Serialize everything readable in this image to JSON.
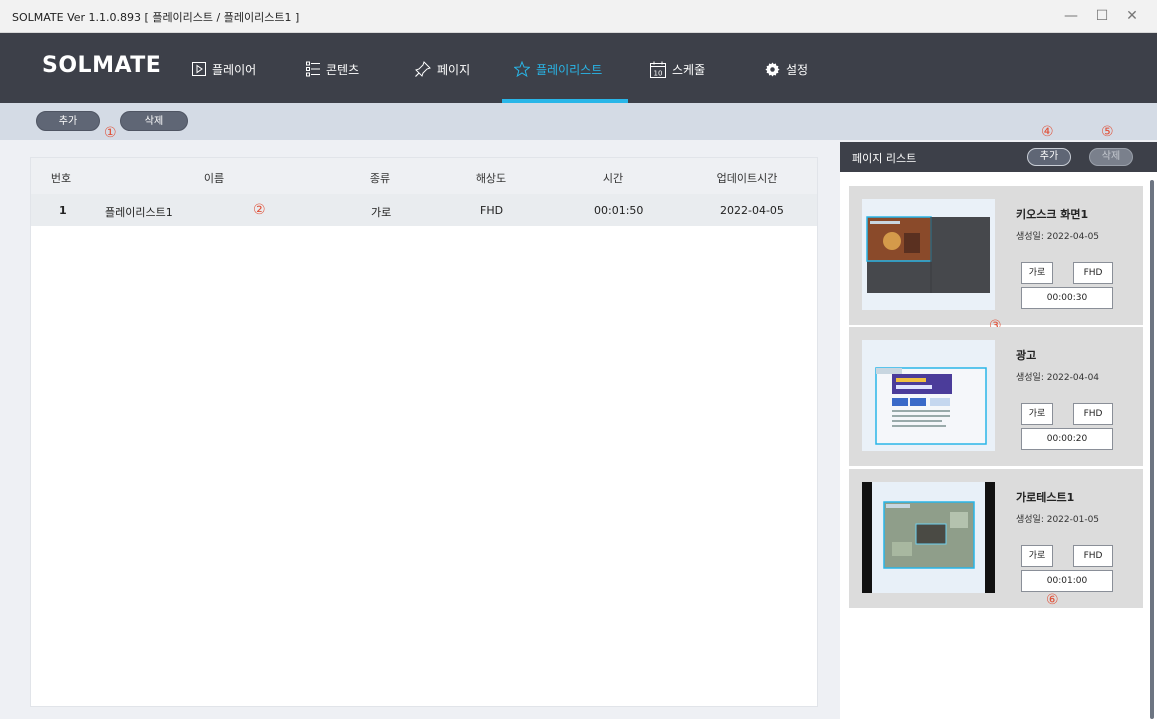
{
  "window": {
    "title": "SOLMATE Ver 1.1.0.893  [ 플레이리스트 / 플레이리스트1 ]",
    "minimize": "—",
    "maximize": "☐",
    "close": "✕"
  },
  "nav": {
    "logo": "SOLMATE",
    "items": [
      {
        "label": "플레이어",
        "icon": "play-icon"
      },
      {
        "label": "콘텐츠",
        "icon": "list-icon"
      },
      {
        "label": "페이지",
        "icon": "pin-icon"
      },
      {
        "label": "플레이리스트",
        "icon": "star-icon",
        "active": true
      },
      {
        "label": "스케줄",
        "icon": "calendar-icon"
      },
      {
        "label": "설정",
        "icon": "gear-icon"
      }
    ],
    "accent_color": "#29b6e8"
  },
  "toolbar": {
    "add_label": "추가",
    "delete_label": "삭제"
  },
  "markers": [
    "①",
    "②",
    "③",
    "④",
    "⑤",
    "⑥"
  ],
  "table": {
    "columns": [
      "번호",
      "이름",
      "종류",
      "해상도",
      "시간",
      "업데이트시간"
    ],
    "rows": [
      {
        "no": "1",
        "name": "플레이리스트1",
        "type": "가로",
        "resolution": "FHD",
        "time": "00:01:50",
        "updated": "2022-04-05"
      }
    ]
  },
  "page_list": {
    "title": "페이지 리스트",
    "add_label": "추가",
    "delete_label": "삭제",
    "cards": [
      {
        "title": "키오스크 화면1",
        "date": "생성일: 2022-04-05",
        "orientation": "가로",
        "resolution": "FHD",
        "duration": "00:00:30"
      },
      {
        "title": "광고",
        "date": "생성일: 2022-04-04",
        "orientation": "가로",
        "resolution": "FHD",
        "duration": "00:00:20"
      },
      {
        "title": "가로테스트1",
        "date": "생성일: 2022-01-05",
        "orientation": "가로",
        "resolution": "FHD",
        "duration": "00:01:00"
      }
    ]
  }
}
